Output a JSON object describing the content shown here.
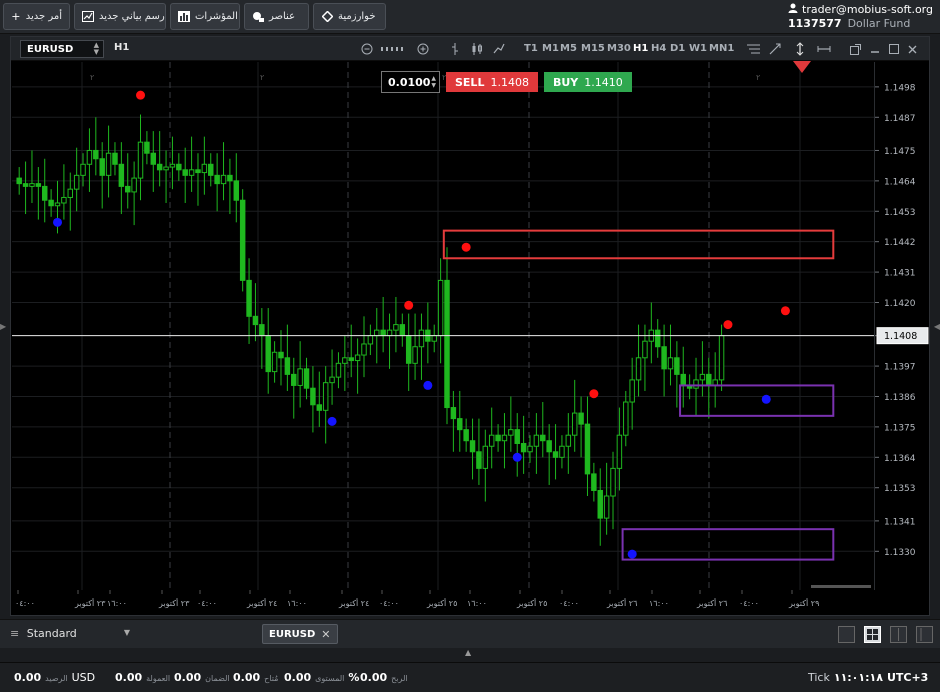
{
  "toolbar": {
    "buttons": [
      {
        "label": "أمر جديد",
        "icon": "+"
      },
      {
        "label": "رسم بياني جديد",
        "icon": "chart"
      },
      {
        "label": "المؤشرات",
        "icon": "bars"
      },
      {
        "label": "عناصر",
        "icon": "elements"
      },
      {
        "label": "خوارزمية",
        "icon": "diamond"
      }
    ]
  },
  "account": {
    "email": "trader@mobius-soft.org",
    "number": "1137577",
    "fund": "Dollar Fund"
  },
  "chart_toolbar": {
    "symbol": "EURUSD",
    "timeframe": "H1",
    "timeframes": [
      "T1",
      "M1",
      "M5",
      "M15",
      "M30",
      "H1",
      "H4",
      "D1",
      "W1",
      "MN1"
    ],
    "active_timeframe": "H1"
  },
  "order_panel": {
    "lot": "0.0100",
    "sell_label": "SELL",
    "sell_price": "1.1408",
    "buy_label": "BUY",
    "buy_price": "1.1410"
  },
  "colors": {
    "bull": "#1fb81f",
    "bear": "#1fb81f",
    "sell": "#e0393b",
    "buy": "#2fa84f",
    "red_dot": "#ff1010",
    "blue_dot": "#1414ff",
    "red_box": "#e53c3c",
    "purple_box": "#7a32b0"
  },
  "chart_data": {
    "type": "candlestick",
    "symbol": "EURUSD",
    "current_price": 1.1408,
    "current_price_label": "1.1408",
    "y_ticks": [
      "1.1498",
      "1.1487",
      "1.1475",
      "1.1464",
      "1.1453",
      "1.1442",
      "1.1431",
      "1.1420",
      "1.1408",
      "1.1397",
      "1.1386",
      "1.1375",
      "1.1364",
      "1.1353",
      "1.1341",
      "1.1330"
    ],
    "ylim": [
      1.1316,
      1.1507
    ],
    "x_ticks": [
      "٠٤:٠٠",
      "٢٣ أكتوبر",
      "١٦:٠٠",
      "٢٣ أكتوبر",
      "٠٤:٠٠",
      "٢٤ أكتوبر",
      "١٦:٠٠",
      "٢٤ أكتوبر",
      "٠٤:٠٠",
      "٢٥ أكتوبر",
      "١٦:٠٠",
      "٢٥ أكتوبر",
      "٠٤:٠٠",
      "٢٦ أكتوبر",
      "١٦:٠٠",
      "٢٦ أكتوبر",
      "٠٤:٠٠",
      "٢٩ أكتوبر"
    ],
    "session_markers": [
      "٢",
      "٢",
      "٢",
      "٢",
      "٢"
    ],
    "close_series": [
      1.1463,
      1.1462,
      1.1463,
      1.1462,
      1.1457,
      1.1455,
      1.1456,
      1.1458,
      1.1461,
      1.1466,
      1.147,
      1.1475,
      1.1472,
      1.1466,
      1.1474,
      1.147,
      1.1462,
      1.146,
      1.1465,
      1.1478,
      1.1474,
      1.147,
      1.1468,
      1.1469,
      1.147,
      1.1468,
      1.1466,
      1.1468,
      1.1467,
      1.147,
      1.1466,
      1.1463,
      1.1466,
      1.1464,
      1.1457,
      1.1428,
      1.1415,
      1.1412,
      1.1408,
      1.1395,
      1.1402,
      1.14,
      1.1394,
      1.139,
      1.1396,
      1.1389,
      1.1383,
      1.1381,
      1.1391,
      1.1393,
      1.1398,
      1.14,
      1.1399,
      1.1401,
      1.1405,
      1.1408,
      1.141,
      1.1408,
      1.141,
      1.1412,
      1.1408,
      1.1398,
      1.1404,
      1.141,
      1.1406,
      1.1408,
      1.1428,
      1.1382,
      1.1378,
      1.1374,
      1.137,
      1.1366,
      1.136,
      1.1368,
      1.1372,
      1.137,
      1.1372,
      1.1374,
      1.1369,
      1.1366,
      1.1368,
      1.1372,
      1.137,
      1.1366,
      1.1364,
      1.1368,
      1.1372,
      1.138,
      1.1376,
      1.1358,
      1.1352,
      1.1342,
      1.135,
      1.136,
      1.1372,
      1.1384,
      1.1392,
      1.14,
      1.1406,
      1.141,
      1.1404,
      1.1396,
      1.14,
      1.1394,
      1.139,
      1.1389,
      1.1392,
      1.1394,
      1.139,
      1.1392,
      1.1408
    ],
    "red_signals": [
      {
        "i": 19,
        "price": 1.1495
      },
      {
        "i": 61,
        "price": 1.1419
      },
      {
        "i": 70,
        "price": 1.144
      },
      {
        "i": 90,
        "price": 1.1387
      },
      {
        "i": 111,
        "price": 1.1412
      },
      {
        "i": 120,
        "price": 1.1417
      }
    ],
    "blue_signals": [
      {
        "i": 6,
        "price": 1.1449
      },
      {
        "i": 49,
        "price": 1.1377
      },
      {
        "i": 64,
        "price": 1.139
      },
      {
        "i": 78,
        "price": 1.1364
      },
      {
        "i": 96,
        "price": 1.1329
      },
      {
        "i": 117,
        "price": 1.1385
      }
    ],
    "boxes": [
      {
        "kind": "red",
        "i0": 67,
        "i1": 128,
        "p_hi": 1.1446,
        "p_lo": 1.1436
      },
      {
        "kind": "purple",
        "i0": 104,
        "i1": 128,
        "p_hi": 1.139,
        "p_lo": 1.1379
      },
      {
        "kind": "purple",
        "i0": 95,
        "i1": 128,
        "p_hi": 1.1338,
        "p_lo": 1.1327
      }
    ]
  },
  "bottom_tabs": {
    "template": "Standard",
    "symbol_tab": "EURUSD"
  },
  "status": {
    "balance_label": "الرصيد",
    "balance": "0.00",
    "currency": "USD",
    "commission_label": "العمولة",
    "commission": "0.00",
    "margin_label": "الضمان",
    "margin": "0.00",
    "available_label": "مُتاح",
    "available": "0.00",
    "level_label": "المستوى",
    "level": "0.00",
    "level_unit": "%",
    "profit_label": "الربح",
    "profit": "0.00",
    "tick_label": "Tick",
    "time": "١١:٠١:١٨",
    "timezone": "UTC+3"
  }
}
